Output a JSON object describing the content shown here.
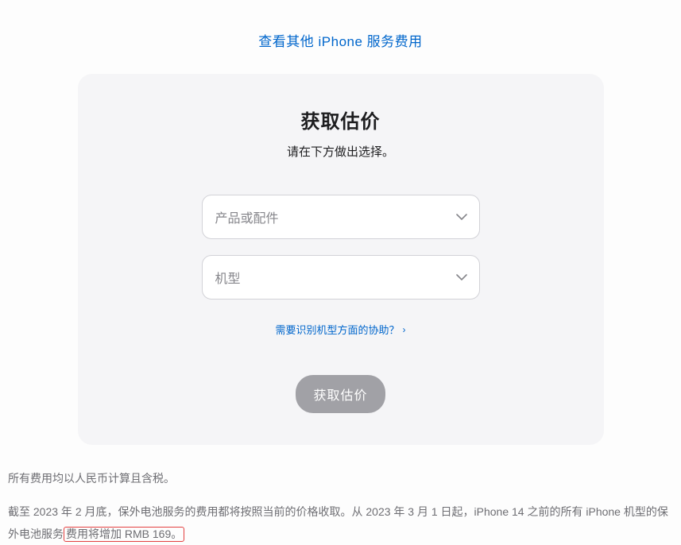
{
  "topLink": {
    "label": "查看其他 iPhone 服务费用"
  },
  "card": {
    "title": "获取估价",
    "subtitle": "请在下方做出选择。",
    "select1": {
      "placeholder": "产品或配件"
    },
    "select2": {
      "placeholder": "机型"
    },
    "helpLink": {
      "label": "需要识别机型方面的协助？"
    },
    "submitLabel": "获取估价"
  },
  "footer": {
    "note1": "所有费用均以人民币计算且含税。",
    "note2_pre": "截至 2023 年 2 月底，保外电池服务的费用都将按照当前的价格收取。从 2023 年 3 月 1 日起，iPhone 14 之前的所有 iPhone 机型的保外电池服务",
    "note2_highlight": "费用将增加 RMB 169。"
  }
}
